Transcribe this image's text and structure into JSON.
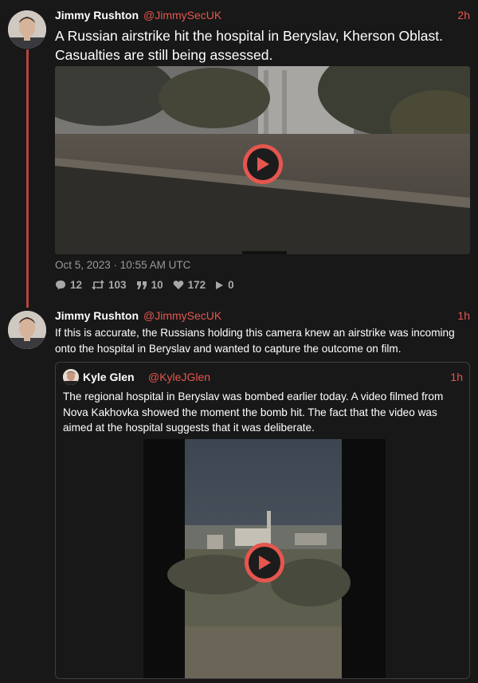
{
  "tweets": [
    {
      "display_name": "Jimmy Rushton",
      "handle": "@JimmySecUK",
      "time": "2h",
      "text": "A Russian airstrike hit the hospital in Beryslav, Kherson Oblast. Casualties are still being assessed.",
      "date": "Oct 5, 2023 · 10:55 AM UTC",
      "stats": {
        "replies": "12",
        "retweets": "103",
        "quotes": "10",
        "likes": "172",
        "views": "0"
      }
    },
    {
      "display_name": "Jimmy Rushton",
      "handle": "@JimmySecUK",
      "time": "1h",
      "text": "If this is accurate, the Russians holding this camera knew an airstrike was incoming onto the hospital in Beryslav and wanted to capture the outcome on film."
    }
  ],
  "quote": {
    "display_name": "Kyle Glen",
    "handle": "@KyleJGlen",
    "time": "1h",
    "text": "The regional hospital in Beryslav was bombed earlier today. A video filmed from Nova Kakhovka  showed the moment the bomb hit. The fact that the video was aimed at the hospital suggests that it was deliberate."
  },
  "colors": {
    "accent": "#e5564f",
    "background": "#181818",
    "thread_line": "#b4453f"
  },
  "icons": [
    "play-icon",
    "reply-icon",
    "retweet-icon",
    "quote-icon",
    "like-icon",
    "views-icon"
  ]
}
